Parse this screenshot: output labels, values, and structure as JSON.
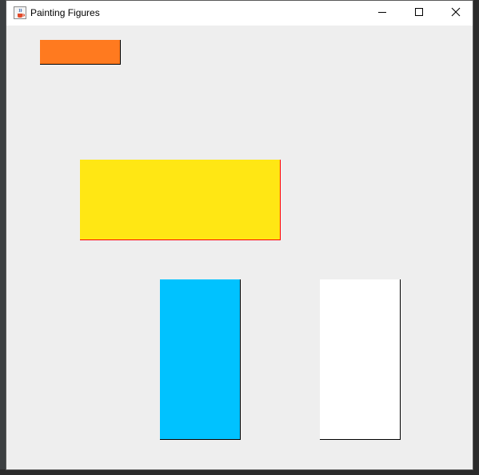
{
  "window": {
    "title": "Painting Figures",
    "icons": {
      "app": "java-cup-icon",
      "minimize": "minimize-icon",
      "maximize": "maximize-icon",
      "close": "close-icon"
    }
  },
  "figures": [
    {
      "name": "orange-rectangle",
      "fill": "#ff7a1f",
      "outline": "#000000"
    },
    {
      "name": "yellow-rectangle",
      "fill": "#ffe714",
      "outline": "#ff0000"
    },
    {
      "name": "blue-rectangle",
      "fill": "#00c2ff",
      "outline": "#000000"
    },
    {
      "name": "white-rectangle",
      "fill": "#ffffff",
      "outline": "#000000"
    }
  ],
  "colors": {
    "canvas_background": "#eeeeee",
    "titlebar_background": "#ffffff"
  }
}
